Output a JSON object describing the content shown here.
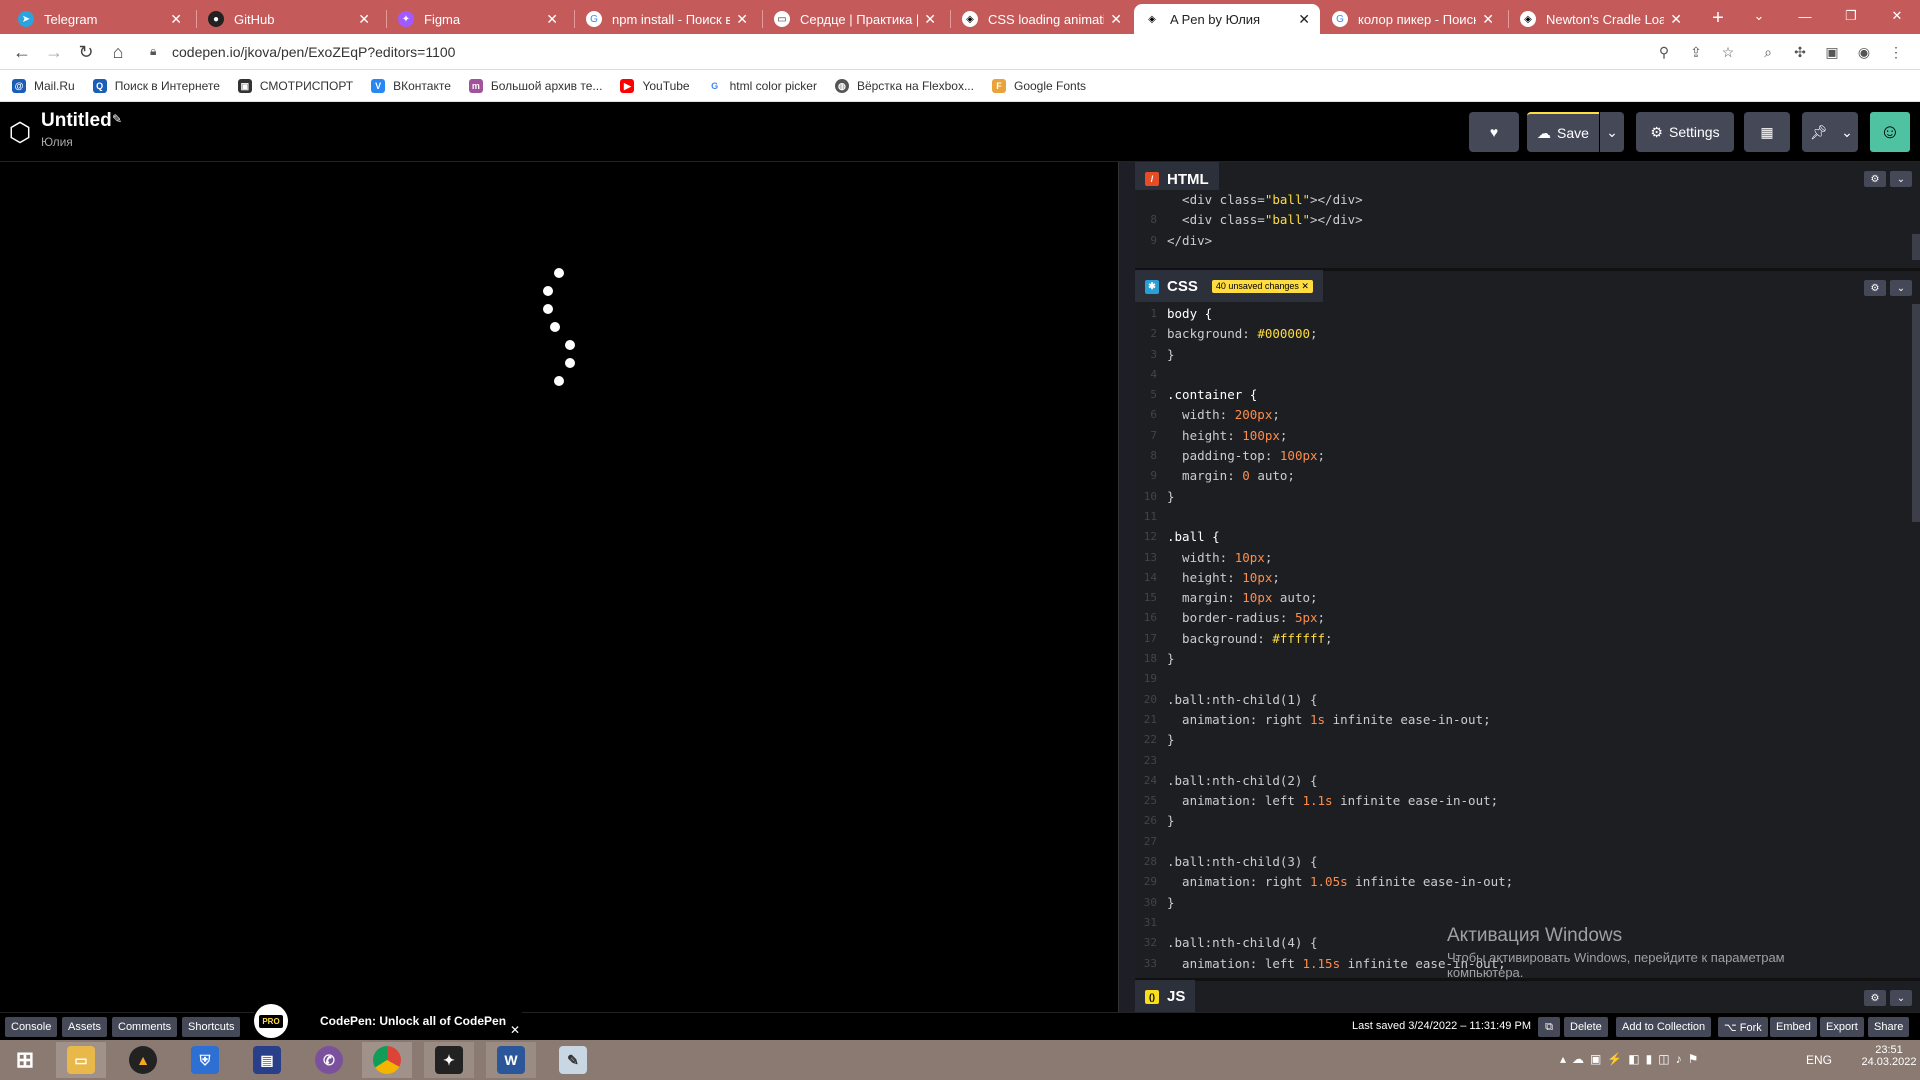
{
  "browser": {
    "tabs": [
      {
        "label": "Telegram",
        "active": false
      },
      {
        "label": "GitHub",
        "active": false
      },
      {
        "label": "Figma",
        "active": false
      },
      {
        "label": "npm install - Поиск в G",
        "active": false
      },
      {
        "label": "Сердце | Практика | W",
        "active": false
      },
      {
        "label": "CSS loading animation",
        "active": false
      },
      {
        "label": "A Pen by Юлия",
        "active": true
      },
      {
        "label": "колор пикер - Поиск в",
        "active": false
      },
      {
        "label": "Newton's Cradle Loade",
        "active": false
      }
    ],
    "new_tab": "+",
    "url": "codepen.io/jkova/pen/ExoZEqP?editors=1100",
    "bookmarks": [
      "Mail.Ru",
      "Поиск в Интернете",
      "СМОТРИСПОРТ",
      "ВКонтакте",
      "Большой архив те...",
      "YouTube",
      "html color picker",
      "Вёрстка на Flexbox...",
      "Google Fonts"
    ]
  },
  "codepen": {
    "title": "Untitled",
    "author": "Юлия",
    "save_label": "Save",
    "settings_label": "Settings",
    "html_pane": {
      "label": "HTML",
      "lines": [
        {
          "n": "",
          "text": "  <div class=\"ball\"></div>"
        },
        {
          "n": "8",
          "text": "  <div class=\"ball\"></div>"
        },
        {
          "n": "9",
          "text": "</div>"
        }
      ]
    },
    "css_pane": {
      "label": "CSS",
      "unsaved": "40 unsaved changes ✕",
      "lines": [
        {
          "n": "1",
          "text": "body {"
        },
        {
          "n": "2",
          "text": "background: #000000;"
        },
        {
          "n": "3",
          "text": "}"
        },
        {
          "n": "4",
          "text": ""
        },
        {
          "n": "5",
          "text": ".container {"
        },
        {
          "n": "6",
          "text": "  width: 200px;"
        },
        {
          "n": "7",
          "text": "  height: 100px;"
        },
        {
          "n": "8",
          "text": "  padding-top: 100px;"
        },
        {
          "n": "9",
          "text": "  margin: 0 auto;"
        },
        {
          "n": "10",
          "text": "}"
        },
        {
          "n": "11",
          "text": ""
        },
        {
          "n": "12",
          "text": ".ball {"
        },
        {
          "n": "13",
          "text": "  width: 10px;"
        },
        {
          "n": "14",
          "text": "  height: 10px;"
        },
        {
          "n": "15",
          "text": "  margin: 10px auto;"
        },
        {
          "n": "16",
          "text": "  border-radius: 5px;"
        },
        {
          "n": "17",
          "text": "  background: #ffffff;"
        },
        {
          "n": "18",
          "text": "}"
        },
        {
          "n": "19",
          "text": ""
        },
        {
          "n": "20",
          "text": ".ball:nth-child(1) {"
        },
        {
          "n": "21",
          "text": "  animation: right 1s infinite ease-in-out;"
        },
        {
          "n": "22",
          "text": "}"
        },
        {
          "n": "23",
          "text": ""
        },
        {
          "n": "24",
          "text": ".ball:nth-child(2) {"
        },
        {
          "n": "25",
          "text": "  animation: left 1.1s infinite ease-in-out;"
        },
        {
          "n": "26",
          "text": "}"
        },
        {
          "n": "27",
          "text": ""
        },
        {
          "n": "28",
          "text": ".ball:nth-child(3) {"
        },
        {
          "n": "29",
          "text": "  animation: right 1.05s infinite ease-in-out;"
        },
        {
          "n": "30",
          "text": "}"
        },
        {
          "n": "31",
          "text": ""
        },
        {
          "n": "32",
          "text": ".ball:nth-child(4) {"
        },
        {
          "n": "33",
          "text": "  animation: left 1.15s infinite ease-in-out;"
        }
      ]
    },
    "js_pane": {
      "label": "JS"
    },
    "footer": {
      "left_buttons": [
        "Console",
        "Assets",
        "Comments",
        "Shortcuts"
      ],
      "promo": "CodePen: Unlock all of CodePen",
      "pro_badge": "PRO",
      "last_saved": "Last saved 3/24/2022 – 11:31:49 PM",
      "right_buttons": [
        "Delete",
        "Add to Collection",
        "⌥ Fork",
        "Embed",
        "Export",
        "Share"
      ]
    }
  },
  "watermark": {
    "title": "Активация Windows",
    "line1": "Чтобы активировать Windows, перейдите к параметрам",
    "line2": "компьютера."
  },
  "taskbar": {
    "lang": "ENG",
    "time": "23:51",
    "date": "24.03.2022"
  },
  "colors": {
    "tabstrip": "#c45a5a",
    "codepen_accent": "#ffdd40",
    "editor_bg": "#1d1e22"
  }
}
